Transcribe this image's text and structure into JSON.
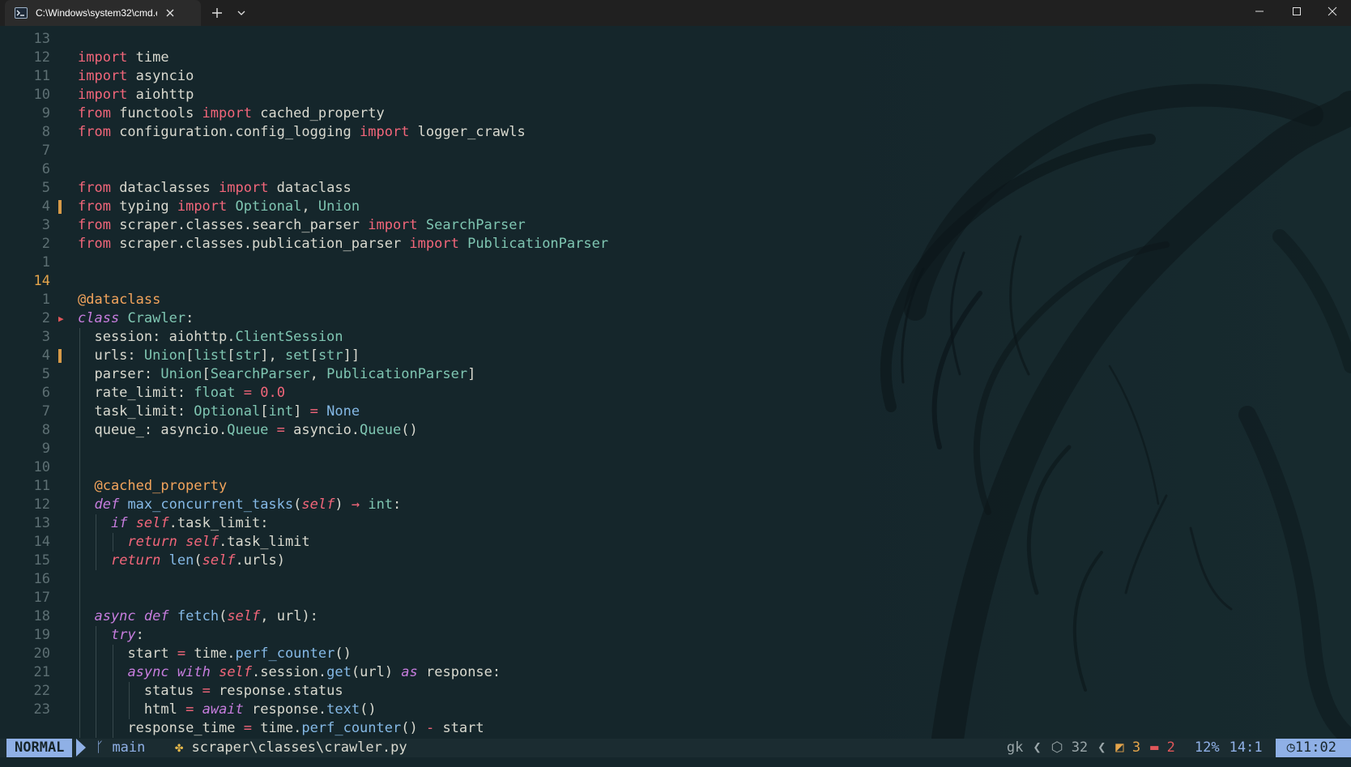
{
  "window": {
    "tab_title": "C:\\Windows\\system32\\cmd.ex"
  },
  "editor": {
    "lines": [
      {
        "num": "13",
        "segs": []
      },
      {
        "num": "12",
        "segs": [
          [
            "kw",
            "import"
          ],
          [
            "nm",
            " time"
          ]
        ]
      },
      {
        "num": "11",
        "segs": [
          [
            "kw",
            "import"
          ],
          [
            "nm",
            " asyncio"
          ]
        ]
      },
      {
        "num": "10",
        "segs": [
          [
            "kw",
            "import"
          ],
          [
            "nm",
            " aiohttp"
          ]
        ]
      },
      {
        "num": "9",
        "segs": [
          [
            "kw",
            "from"
          ],
          [
            "nm",
            " functools "
          ],
          [
            "kw",
            "import"
          ],
          [
            "nm",
            " cached_property"
          ]
        ]
      },
      {
        "num": "8",
        "segs": [
          [
            "kw",
            "from"
          ],
          [
            "nm",
            " configuration.config_logging "
          ],
          [
            "kw",
            "import"
          ],
          [
            "nm",
            " logger_crawls"
          ]
        ]
      },
      {
        "num": "7",
        "segs": []
      },
      {
        "num": "6",
        "segs": []
      },
      {
        "num": "5",
        "segs": [
          [
            "kw",
            "from"
          ],
          [
            "nm",
            " dataclasses "
          ],
          [
            "kw",
            "import"
          ],
          [
            "nm",
            " dataclass"
          ]
        ]
      },
      {
        "num": "4",
        "mod": true,
        "segs": [
          [
            "kw",
            "from"
          ],
          [
            "nm",
            " typing "
          ],
          [
            "kw",
            "import"
          ],
          [
            "ty",
            " Optional"
          ],
          [
            "nm",
            ", "
          ],
          [
            "ty",
            "Union"
          ]
        ]
      },
      {
        "num": "3",
        "segs": [
          [
            "kw",
            "from"
          ],
          [
            "nm",
            " scraper.classes.search_parser "
          ],
          [
            "kw",
            "import"
          ],
          [
            "ty",
            " SearchParser"
          ]
        ]
      },
      {
        "num": "2",
        "segs": [
          [
            "kw",
            "from"
          ],
          [
            "nm",
            " scraper.classes.publication_parser "
          ],
          [
            "kw",
            "import"
          ],
          [
            "ty",
            " PublicationParser"
          ]
        ]
      },
      {
        "num": "1",
        "segs": []
      },
      {
        "num": "14",
        "cur": true,
        "segs": []
      },
      {
        "num": "1",
        "segs": [
          [
            "dc",
            "@dataclass"
          ]
        ]
      },
      {
        "num": "2",
        "mark": true,
        "segs": [
          [
            "kwi",
            "class"
          ],
          [
            "nm",
            " "
          ],
          [
            "cl",
            "Crawler"
          ],
          [
            "nm",
            ":"
          ]
        ]
      },
      {
        "num": "3",
        "indent": 1,
        "segs": [
          [
            "nm",
            "session: aiohttp."
          ],
          [
            "ty",
            "ClientSession"
          ]
        ]
      },
      {
        "num": "4",
        "mod": true,
        "indent": 1,
        "segs": [
          [
            "nm",
            "urls: "
          ],
          [
            "ty",
            "Union"
          ],
          [
            "nm",
            "["
          ],
          [
            "ty",
            "list"
          ],
          [
            "nm",
            "["
          ],
          [
            "ty",
            "str"
          ],
          [
            "nm",
            "], "
          ],
          [
            "ty",
            "set"
          ],
          [
            "nm",
            "["
          ],
          [
            "ty",
            "str"
          ],
          [
            "nm",
            "]]"
          ]
        ]
      },
      {
        "num": "5",
        "indent": 1,
        "segs": [
          [
            "nm",
            "parser: "
          ],
          [
            "ty",
            "Union"
          ],
          [
            "nm",
            "["
          ],
          [
            "ty",
            "SearchParser"
          ],
          [
            "nm",
            ", "
          ],
          [
            "ty",
            "PublicationParser"
          ],
          [
            "nm",
            "]"
          ]
        ]
      },
      {
        "num": "6",
        "indent": 1,
        "segs": [
          [
            "nm",
            "rate_limit: "
          ],
          [
            "ty",
            "float"
          ],
          [
            "nm",
            " "
          ],
          [
            "op",
            "="
          ],
          [
            "nm",
            " "
          ],
          [
            "nu",
            "0.0"
          ]
        ]
      },
      {
        "num": "7",
        "indent": 1,
        "segs": [
          [
            "nm",
            "task_limit: "
          ],
          [
            "ty",
            "Optional"
          ],
          [
            "nm",
            "["
          ],
          [
            "ty",
            "int"
          ],
          [
            "nm",
            "] "
          ],
          [
            "op",
            "="
          ],
          [
            "nm",
            " "
          ],
          [
            "fn",
            "None"
          ]
        ]
      },
      {
        "num": "8",
        "indent": 1,
        "segs": [
          [
            "nm",
            "queue_: asyncio."
          ],
          [
            "ty",
            "Queue"
          ],
          [
            "nm",
            " "
          ],
          [
            "op",
            "="
          ],
          [
            "nm",
            " asyncio."
          ],
          [
            "ty",
            "Queue"
          ],
          [
            "nm",
            "()"
          ]
        ]
      },
      {
        "num": "9",
        "indent": 1,
        "segs": []
      },
      {
        "num": "10",
        "indent": 1,
        "segs": []
      },
      {
        "num": "11",
        "indent": 1,
        "segs": [
          [
            "dc",
            "@cached_property"
          ]
        ]
      },
      {
        "num": "12",
        "indent": 1,
        "segs": [
          [
            "kwi",
            "def"
          ],
          [
            "nm",
            " "
          ],
          [
            "fn",
            "max_concurrent_tasks"
          ],
          [
            "nm",
            "("
          ],
          [
            "sf",
            "self"
          ],
          [
            "nm",
            ") "
          ],
          [
            "op",
            "→"
          ],
          [
            "nm",
            " "
          ],
          [
            "ty",
            "int"
          ],
          [
            "nm",
            ":"
          ]
        ]
      },
      {
        "num": "13",
        "indent": 2,
        "segs": [
          [
            "kwi",
            "if"
          ],
          [
            "nm",
            " "
          ],
          [
            "sf",
            "self"
          ],
          [
            "nm",
            ".task_limit:"
          ]
        ]
      },
      {
        "num": "14",
        "indent": 3,
        "segs": [
          [
            "sf",
            "return"
          ],
          [
            "nm",
            " "
          ],
          [
            "sf",
            "self"
          ],
          [
            "nm",
            ".task_limit"
          ]
        ]
      },
      {
        "num": "15",
        "indent": 2,
        "segs": [
          [
            "sf",
            "return"
          ],
          [
            "nm",
            " "
          ],
          [
            "fn",
            "len"
          ],
          [
            "nm",
            "("
          ],
          [
            "sf",
            "self"
          ],
          [
            "nm",
            ".urls)"
          ]
        ]
      },
      {
        "num": "16",
        "indent": 1,
        "segs": []
      },
      {
        "num": "17",
        "indent": 1,
        "segs": []
      },
      {
        "num": "18",
        "indent": 1,
        "segs": [
          [
            "kwi",
            "async"
          ],
          [
            "nm",
            " "
          ],
          [
            "kwi",
            "def"
          ],
          [
            "nm",
            " "
          ],
          [
            "fn",
            "fetch"
          ],
          [
            "nm",
            "("
          ],
          [
            "sf",
            "self"
          ],
          [
            "nm",
            ", url):"
          ]
        ]
      },
      {
        "num": "19",
        "indent": 2,
        "segs": [
          [
            "kwi",
            "try"
          ],
          [
            "nm",
            ":"
          ]
        ]
      },
      {
        "num": "20",
        "indent": 3,
        "segs": [
          [
            "nm",
            "start "
          ],
          [
            "op",
            "="
          ],
          [
            "nm",
            " time."
          ],
          [
            "fn",
            "perf_counter"
          ],
          [
            "nm",
            "()"
          ]
        ]
      },
      {
        "num": "21",
        "indent": 3,
        "segs": [
          [
            "kwi",
            "async"
          ],
          [
            "nm",
            " "
          ],
          [
            "kwi",
            "with"
          ],
          [
            "nm",
            " "
          ],
          [
            "sf",
            "self"
          ],
          [
            "nm",
            ".session."
          ],
          [
            "fn",
            "get"
          ],
          [
            "nm",
            "(url) "
          ],
          [
            "kwi",
            "as"
          ],
          [
            "nm",
            " response:"
          ]
        ]
      },
      {
        "num": "22",
        "indent": 4,
        "segs": [
          [
            "nm",
            "status "
          ],
          [
            "op",
            "="
          ],
          [
            "nm",
            " response.status"
          ]
        ]
      },
      {
        "num": "23",
        "indent": 4,
        "segs": [
          [
            "nm",
            "html "
          ],
          [
            "op",
            "="
          ],
          [
            "nm",
            " "
          ],
          [
            "kwi",
            "await"
          ],
          [
            "nm",
            " response."
          ],
          [
            "fn",
            "text"
          ],
          [
            "nm",
            "()"
          ]
        ]
      },
      {
        "num": "",
        "indent": 3,
        "segs": [
          [
            "nm",
            "response_time "
          ],
          [
            "op",
            "="
          ],
          [
            "nm",
            " time."
          ],
          [
            "fn",
            "perf_counter"
          ],
          [
            "nm",
            "() "
          ],
          [
            "op",
            "-"
          ],
          [
            "nm",
            " start"
          ]
        ]
      }
    ]
  },
  "statusline": {
    "mode": "NORMAL",
    "branch": "main",
    "file_icon": "python-icon",
    "file": "scraper\\classes\\crawler.py",
    "gk": "gk",
    "lsp_count": "32",
    "warnings": "3",
    "errors": "2",
    "percent": "12%",
    "position": "14:1",
    "time": "11:02",
    "colors": {
      "mode_bg": "#8fb0e6",
      "warn": "#e5a54b",
      "error": "#e0575a"
    }
  }
}
